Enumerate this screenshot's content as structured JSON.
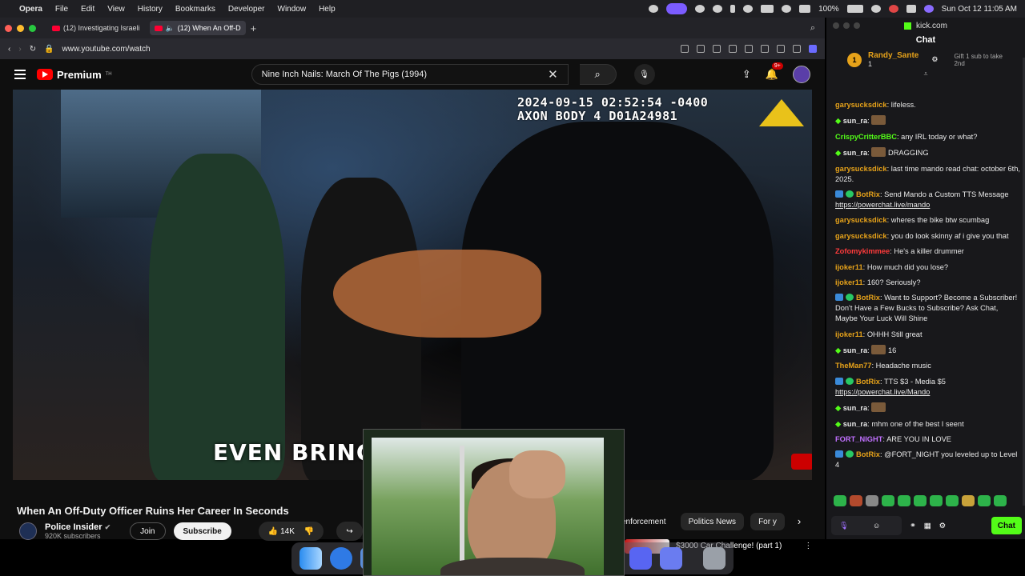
{
  "menubar": {
    "app": "Opera",
    "items": [
      "File",
      "Edit",
      "View",
      "History",
      "Bookmarks",
      "Developer",
      "Window",
      "Help"
    ],
    "battery": "100%",
    "clock": "Sun Oct 12  11:05 AM"
  },
  "browser": {
    "tabs": [
      {
        "label": "(12) Investigating Israeli"
      },
      {
        "label": "(12) When An Off-D"
      }
    ],
    "url": "www.youtube.com/watch"
  },
  "youtube": {
    "brand": "Premium",
    "brand_tm": "TH",
    "search_value": "Nine Inch Nails: March Of The Pigs (1994)",
    "notif_count": "9+",
    "player": {
      "timestamp_line1": "2024-09-15 02:52:54 -0400",
      "timestamp_line2": "AXON BODY 4 D01A24981",
      "caption": "EVEN BRING"
    },
    "video_title": "When An Off-Duty Officer Ruins Her Career In Seconds",
    "channel_name": "Police Insider",
    "channel_subs": "920K subscribers",
    "join_label": "Join",
    "subscribe_label": "Subscribe",
    "likes": "14K",
    "chips": [
      "enforcement",
      "Politics News",
      "For y"
    ],
    "rec_title": "$3000 Car Challenge! (part 1)"
  },
  "kick": {
    "tab_title": "kick.com",
    "chat_title": "Chat",
    "gifter": {
      "rank": "1",
      "name": "Randy_Sante",
      "count": "1",
      "cta": "Gift 1 sub to take 2nd"
    },
    "messages": [
      {
        "user": "garysucksdick",
        "color": "#e6a21a",
        "text": "lifeless."
      },
      {
        "user": "sun_ra",
        "color": "#e8e8e8",
        "text": "",
        "star": true,
        "emote": true
      },
      {
        "user": "CrispyCritterBBC",
        "color": "#53fc18",
        "text": "any IRL today or what?"
      },
      {
        "user": "sun_ra",
        "color": "#e8e8e8",
        "text": "DRAGGING",
        "star": true,
        "emote": true
      },
      {
        "user": "garysucksdick",
        "color": "#e6a21a",
        "text": "last time mando read chat: october 6th, 2025."
      },
      {
        "user": "BotRix",
        "color": "#e6a21a",
        "bot": true,
        "text": "Send Mando a Custom TTS Message",
        "link": "https://powerchat.live/mando"
      },
      {
        "user": "garysucksdick",
        "color": "#e6a21a",
        "text": "wheres the bike btw scumbag"
      },
      {
        "user": "garysucksdick",
        "color": "#e6a21a",
        "text": "you do look skinny af i give you that"
      },
      {
        "user": "Zofomykimmee",
        "color": "#ff3b3b",
        "text": "He's a killer drummer"
      },
      {
        "user": "ijoker11",
        "color": "#e6a21a",
        "text": "How much did you lose?"
      },
      {
        "user": "ijoker11",
        "color": "#e6a21a",
        "text": "160? Seriously?"
      },
      {
        "user": "BotRix",
        "color": "#e6a21a",
        "bot": true,
        "text": "Want to Support? Become a Subscriber! Don't Have a Few Bucks to Subscribe? Ask Chat, Maybe Your Luck Will Shine"
      },
      {
        "user": "ijoker11",
        "color": "#e6a21a",
        "text": "OHHH Still great"
      },
      {
        "user": "sun_ra",
        "color": "#e8e8e8",
        "text": "16",
        "star": true,
        "emote": true
      },
      {
        "user": "TheMan77",
        "color": "#e6a21a",
        "text": "Headache music"
      },
      {
        "user": "BotRix",
        "color": "#e6a21a",
        "bot": true,
        "text": "TTS $3 - Media $5",
        "link": "https://powerchat.live/Mando"
      },
      {
        "user": "sun_ra",
        "color": "#e8e8e8",
        "text": "",
        "star": true,
        "emote": true
      },
      {
        "user": "sun_ra",
        "color": "#e8e8e8",
        "text": "mhm one of the best I seent",
        "star": true
      },
      {
        "user": "FORT_NIGHT",
        "color": "#c070ff",
        "text": "ARE YOU IN LOVE"
      },
      {
        "user": "BotRix",
        "color": "#e6a21a",
        "bot": true,
        "text": "@FORT_NIGHT you leveled up to Level 4"
      }
    ],
    "chat_button": "Chat"
  }
}
